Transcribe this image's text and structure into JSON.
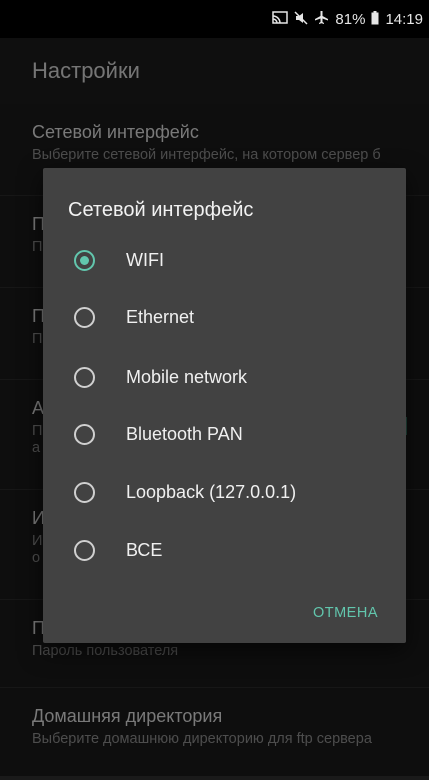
{
  "status_bar": {
    "icons": [
      "cast-icon",
      "mute-icon",
      "airplane-icon",
      "battery-icon"
    ],
    "battery": "81%",
    "time": "14:19"
  },
  "app_bar": {
    "title": "Настройки"
  },
  "preferences": [
    {
      "title": "Сетевой интерфейс",
      "summary": "Выберите сетевой интерфейс, на котором сервер б"
    },
    {
      "title": "П",
      "summary": "П"
    },
    {
      "title": "П",
      "summary": "П"
    },
    {
      "title": "А",
      "summary": "П\nа"
    },
    {
      "title": "И",
      "summary": "И\nо"
    },
    {
      "title": "П",
      "summary": "Пароль пользователя"
    },
    {
      "title": "Домашняя директория",
      "summary": "Выберите домашнюю директорию для ftp сервера"
    }
  ],
  "dialog": {
    "title": "Сетевой интерфейс",
    "options": [
      {
        "label": "WIFI",
        "selected": true
      },
      {
        "label": "Ethernet",
        "selected": false
      },
      {
        "label": "Mobile network",
        "selected": false
      },
      {
        "label": "Bluetooth PAN",
        "selected": false
      },
      {
        "label": "Loopback (127.0.0.1)",
        "selected": false
      },
      {
        "label": "ВСЕ",
        "selected": false
      }
    ],
    "cancel_label": "ОТМЕНА"
  },
  "colors": {
    "accent": "#62c6ad",
    "dialog_bg": "#424242",
    "background": "#1a1a1a"
  }
}
